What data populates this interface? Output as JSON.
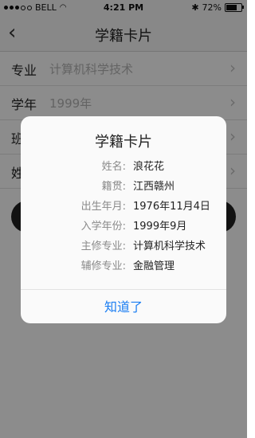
{
  "statusbar": {
    "carrier": "BELL",
    "time": "4:21 PM",
    "battery": "72%"
  },
  "nav": {
    "title": "学籍卡片"
  },
  "form": {
    "rows": [
      {
        "label": "专业",
        "value": "计算机科学技术"
      },
      {
        "label": "学年",
        "value": "1999年"
      },
      {
        "label": "班",
        "value": ""
      },
      {
        "label": "姓",
        "value": ""
      }
    ]
  },
  "dialog": {
    "title": "学籍卡片",
    "fields": [
      {
        "key": "姓名:",
        "value": "浪花花"
      },
      {
        "key": "籍贯:",
        "value": "江西赣州"
      },
      {
        "key": "出生年月:",
        "value": "1976年11月4日"
      },
      {
        "key": "入学年份:",
        "value": "1999年9月"
      },
      {
        "key": "主修专业:",
        "value": "计算机科学技术"
      },
      {
        "key": "辅修专业:",
        "value": "金融管理"
      }
    ],
    "ok_label": "知道了"
  },
  "colors": {
    "accent": "#1a7df2",
    "overlay": "rgba(0,0,0,0.45)"
  }
}
